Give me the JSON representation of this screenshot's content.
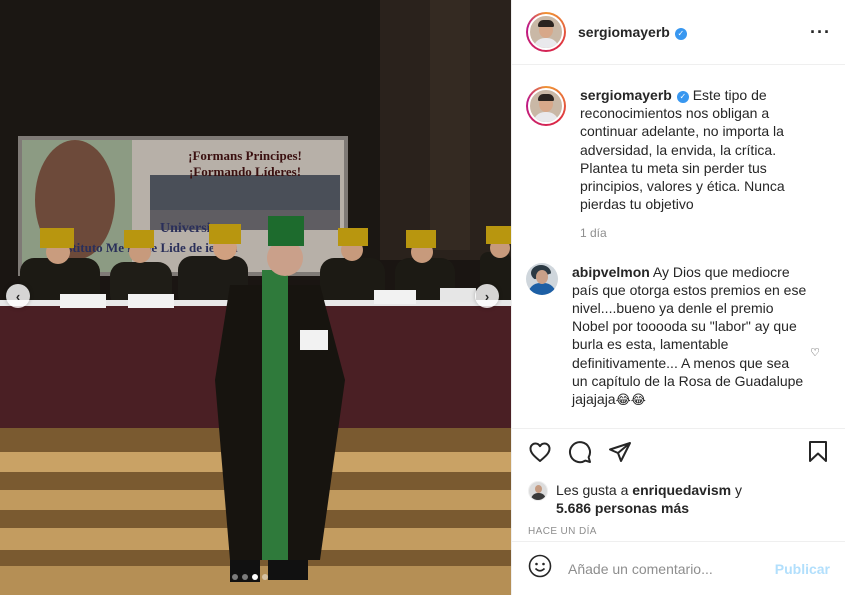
{
  "post": {
    "username": "sergiomayerb",
    "verified": true,
    "caption": "Este tipo de reconocimientos nos obligan a continuar adelante, no importa la adversidad, la envida, la crítica. Plantea tu meta sin perder tus principios, valores y ética. Nunca pierdas tu objetivo",
    "caption_time": "1 día",
    "banner_line1": "¡Formans Principes!",
    "banner_line2": "¡Formando Líderes!",
    "banner_line3": "Universi",
    "banner_line4": "Instituto Me     no de Lide    de     iencia",
    "carousel": {
      "slides": 4,
      "active_index": 2
    }
  },
  "comment": {
    "username": "abipvelmon",
    "text": "Ay Dios que mediocre país que otorga estos premios en ese nivel....bueno ya denle el premio Nobel por tooooda su \"labor\" ay que burla es esta, lamentable definitivamente... A menos que sea un capítulo de la Rosa de Guadalupe jajajaja",
    "emoji": "😂😂"
  },
  "likes": {
    "prefix": "Les gusta a ",
    "user": "enriquedavism",
    "conj": " y",
    "others": "5.686 personas más"
  },
  "time_ago": "HACE UN DÍA",
  "comment_box": {
    "placeholder": "Añade un comentario...",
    "post_label": "Publicar"
  },
  "icons": {
    "like": "heart-icon",
    "comment": "comment-icon",
    "share": "share-icon",
    "save": "bookmark-icon",
    "more": "more-options-icon",
    "emoji": "emoji-icon"
  },
  "colors": {
    "link": "#3897f0",
    "post_disabled": "#b2dffc",
    "secondary_text": "#8e8e8e",
    "primary_text": "#262626"
  }
}
